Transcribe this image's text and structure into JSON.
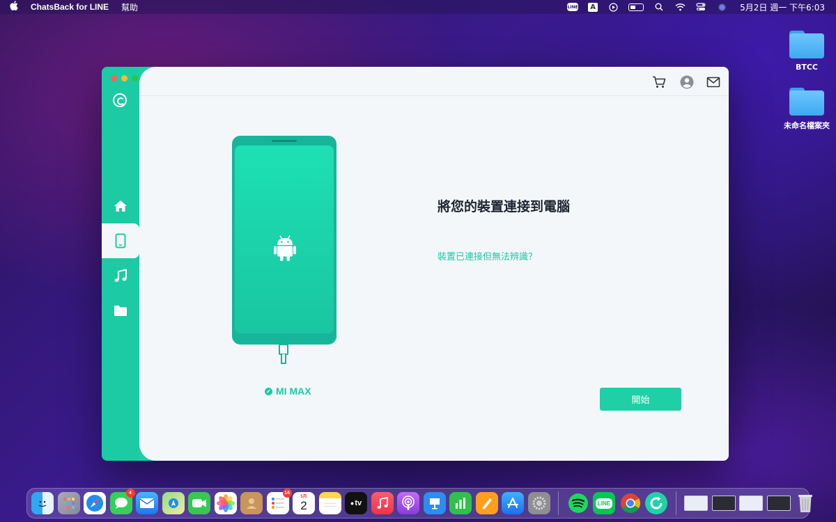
{
  "menubar": {
    "app_name": "ChatsBack for LINE",
    "menus": [
      "幫助"
    ],
    "status_icons": [
      "line-icon",
      "input-a-icon",
      "play-icon",
      "battery-icon",
      "search-icon",
      "wifi-icon",
      "control-center-icon",
      "siri-icon"
    ],
    "line_text": "LINE",
    "input_text": "A",
    "clock": "5月2日 週一 下午6:03"
  },
  "desktop": {
    "folders": [
      {
        "label": "BTCC"
      },
      {
        "label": "未命名檔案夾"
      }
    ]
  },
  "window": {
    "sidebar": {
      "items": [
        {
          "name": "home",
          "icon": "home-icon",
          "active": false
        },
        {
          "name": "device",
          "icon": "phone-icon",
          "active": true
        },
        {
          "name": "music",
          "icon": "music-icon",
          "active": false
        },
        {
          "name": "folder",
          "icon": "folder-icon",
          "active": false
        }
      ]
    },
    "toolbar_icons": [
      "cart-icon",
      "account-icon",
      "mail-icon"
    ],
    "device_name": "MI MAX",
    "headline": "將您的裝置連接到電腦",
    "help_link": "裝置已連接但無法辨識？",
    "start_button": "開始"
  },
  "dock": {
    "apps": [
      "Finder",
      "Launchpad",
      "Safari",
      "Messages",
      "Mail",
      "Maps",
      "FaceTime",
      "Photos",
      "Contacts",
      "Reminders",
      "Calendar",
      "Notes",
      "TV",
      "Music",
      "Podcasts",
      "Keynote",
      "Numbers",
      "Pages",
      "App Store",
      "System Preferences",
      "Spotify",
      "LINE",
      "Chrome",
      "ChatsBack"
    ],
    "messages_badge": "4",
    "reminders_badge": "14",
    "calendar_month": "5月",
    "calendar_day": "2",
    "tv_label": "tv",
    "line_label": "LINE"
  },
  "colors": {
    "accent": "#1ec8a3",
    "sidebar": "#1ccba4",
    "main_bg": "#f4f7fa"
  }
}
